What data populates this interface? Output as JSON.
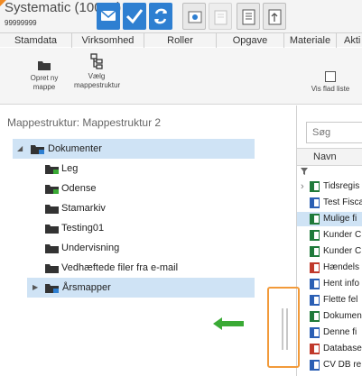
{
  "header": {
    "case_title": "Systematic (10008)",
    "case_number": "99999999",
    "toolbar_icons": [
      "envelope-icon",
      "checkmark-icon",
      "refresh-icon",
      "settings-icon",
      "attachment-icon",
      "document-icon",
      "export-document-icon"
    ],
    "accent_color": "#2e7fd1"
  },
  "tabs": [
    "Stamdata",
    "Virksomhed",
    "Roller",
    "Opgave",
    "Materiale",
    "Akti"
  ],
  "ribbon": {
    "new_folder": "Opret ny mappe",
    "choose_structure": "Vælg mappestruktur",
    "flat_list": "Vis flad liste"
  },
  "tree": {
    "structure_title": "Mappestruktur:  Mappestruktur 2",
    "items": [
      {
        "label": "Dokumenter"
      },
      {
        "label": "Leg"
      },
      {
        "label": "Odense"
      },
      {
        "label": "Stamarkiv"
      },
      {
        "label": "Testing01"
      },
      {
        "label": "Undervisning"
      },
      {
        "label": "Vedhæftede filer fra e-mail"
      },
      {
        "label": "Årsmapper"
      }
    ]
  },
  "search": {
    "placeholder": "Søg"
  },
  "list": {
    "column_header": "Navn",
    "filter_icon": "filter-icon",
    "files": [
      {
        "label": "Tidsregis",
        "type": "excel"
      },
      {
        "label": "Test Fisca",
        "type": "word"
      },
      {
        "label": "Mulige fi",
        "type": "excel"
      },
      {
        "label": "Kunder C",
        "type": "excel"
      },
      {
        "label": "Kunder C",
        "type": "excel"
      },
      {
        "label": "Hændels",
        "type": "pdf"
      },
      {
        "label": "Hent info",
        "type": "word"
      },
      {
        "label": "Flette fel",
        "type": "word"
      },
      {
        "label": "Dokumen",
        "type": "excel"
      },
      {
        "label": "Denne fi",
        "type": "word"
      },
      {
        "label": "Database",
        "type": "pdf"
      },
      {
        "label": "CV DB re",
        "type": "word"
      }
    ]
  },
  "colors": {
    "splitter_highlight": "#f29a3a",
    "arrow": "#3aaa35",
    "selection": "#cfe3f5"
  }
}
